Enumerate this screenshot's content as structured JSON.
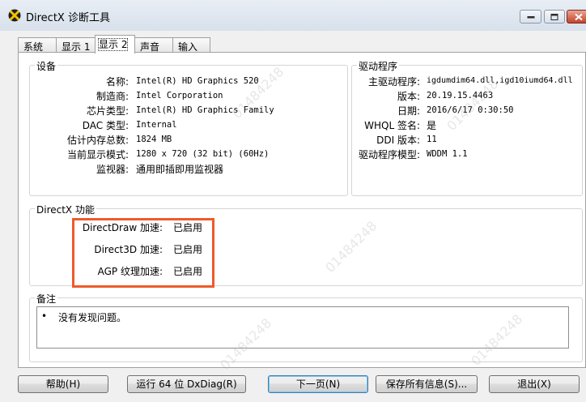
{
  "window": {
    "title": "DirectX 诊断工具"
  },
  "tabs": [
    {
      "label": "系统"
    },
    {
      "label": "显示 1"
    },
    {
      "label": "显示 2"
    },
    {
      "label": "声音"
    },
    {
      "label": "输入"
    }
  ],
  "device": {
    "title": "设备",
    "rows": [
      {
        "label": "名称:",
        "value": "Intel(R) HD Graphics 520"
      },
      {
        "label": "制造商:",
        "value": "Intel Corporation"
      },
      {
        "label": "芯片类型:",
        "value": "Intel(R) HD Graphics Family"
      },
      {
        "label": "DAC 类型:",
        "value": "Internal"
      },
      {
        "label": "估计内存总数:",
        "value": "1824 MB"
      },
      {
        "label": "当前显示模式:",
        "value": "1280 x 720 (32 bit) (60Hz)"
      },
      {
        "label": "监视器:",
        "value": "通用即插即用监视器"
      }
    ]
  },
  "driver": {
    "title": "驱动程序",
    "rows": [
      {
        "label": "主驱动程序:",
        "value": "igdumdim64.dll,igd10iumd64.dll"
      },
      {
        "label": "版本:",
        "value": "20.19.15.4463"
      },
      {
        "label": "日期:",
        "value": "2016/6/17 0:30:50"
      },
      {
        "label": "WHQL 签名:",
        "value": "是"
      },
      {
        "label": "DDI 版本:",
        "value": "11"
      },
      {
        "label": "驱动程序模型:",
        "value": "WDDM 1.1"
      }
    ]
  },
  "directx": {
    "title": "DirectX 功能",
    "rows": [
      {
        "label": "DirectDraw 加速:",
        "value": "已启用"
      },
      {
        "label": "Direct3D 加速:",
        "value": "已启用"
      },
      {
        "label": "AGP 纹理加速:",
        "value": "已启用"
      }
    ]
  },
  "notes": {
    "title": "备注",
    "items": [
      "没有发现问题。"
    ]
  },
  "buttons": {
    "help": "帮助(H)",
    "run64": "运行 64 位 DxDiag(R)",
    "next": "下一页(N)",
    "save": "保存所有信息(S)...",
    "exit": "退出(X)"
  },
  "watermark": "01484248",
  "colors": {
    "highlight": "#ef5a2a",
    "default_button_border": "#3c7fb1"
  }
}
